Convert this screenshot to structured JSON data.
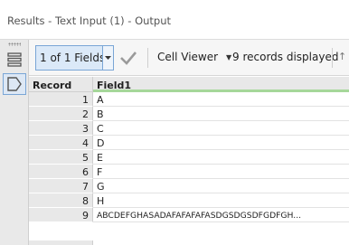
{
  "window": {
    "title": "Results - Text Input (1) - Output"
  },
  "sidebar": {
    "items": [
      {
        "icon": "list-icon"
      },
      {
        "icon": "tag-icon"
      }
    ]
  },
  "toolbar": {
    "field_selector_label": "1 of 1 Fields",
    "cell_viewer_label": "Cell Viewer",
    "records_text": "9 records displayed"
  },
  "table": {
    "columns": [
      "Record",
      "Field1"
    ],
    "rows": [
      {
        "record": "1",
        "value": "A"
      },
      {
        "record": "2",
        "value": "B"
      },
      {
        "record": "3",
        "value": "C"
      },
      {
        "record": "4",
        "value": "D"
      },
      {
        "record": "5",
        "value": "E"
      },
      {
        "record": "6",
        "value": "F"
      },
      {
        "record": "7",
        "value": "G"
      },
      {
        "record": "8",
        "value": "H"
      },
      {
        "record": "9",
        "value": "ABCDEFGHASADAFAFAFAFASDGSDGSDFGDFGH..."
      }
    ]
  },
  "colors": {
    "accent": "#7aa6d6",
    "selected_bg": "#dbe9f8",
    "field_header_underline": "#a6d79a"
  }
}
